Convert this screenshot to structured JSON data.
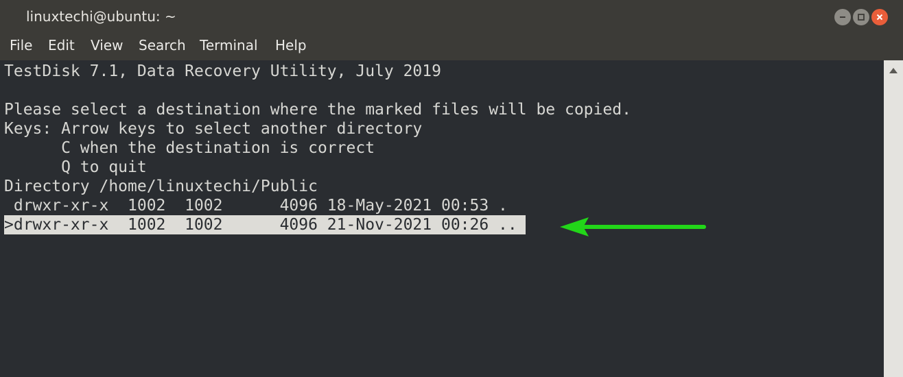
{
  "window": {
    "title": "linuxtechi@ubuntu: ~"
  },
  "menu": {
    "items": [
      "File",
      "Edit",
      "View",
      "Search",
      "Terminal",
      "Help"
    ]
  },
  "terminal": {
    "lines": [
      "TestDisk 7.1, Data Recovery Utility, July 2019",
      "",
      "Please select a destination where the marked files will be copied.",
      "Keys: Arrow keys to select another directory",
      "      C when the destination is correct",
      "      Q to quit",
      "Directory /home/linuxtechi/Public",
      " drwxr-xr-x  1002  1002      4096 18-May-2021 00:53 .",
      ">drwxr-xr-x  1002  1002      4096 21-Nov-2021 00:26 .."
    ]
  },
  "colors": {
    "arrow": "#22d619",
    "close_button": "#e95e3a",
    "terminal_bg": "#2a2d31"
  },
  "icons": {
    "minimize": "minimize-icon",
    "maximize": "maximize-icon",
    "close": "close-icon",
    "scroll_up": "chevron-up-icon",
    "pointer": "arrow-left-icon"
  }
}
